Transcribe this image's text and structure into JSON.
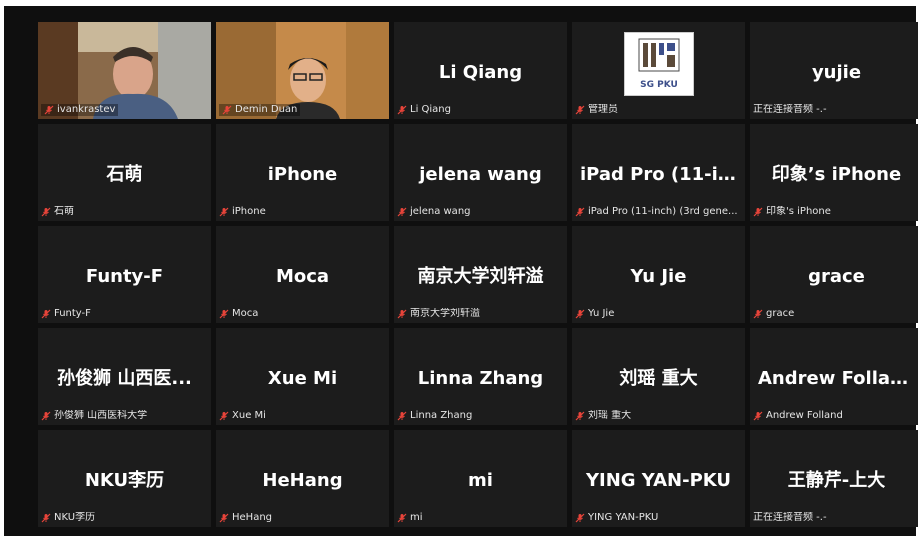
{
  "tiles": [
    {
      "type": "video",
      "variant": "speaker",
      "label": "ivankrastev"
    },
    {
      "type": "video",
      "variant": "man",
      "label": "Demin Duan"
    },
    {
      "title": "Li Qiang",
      "label": "Li Qiang"
    },
    {
      "type": "logo",
      "logo_text": "SG PKU",
      "label": "管理员"
    },
    {
      "title": "yujie",
      "label": "正在连接音频 -.-",
      "no_mic": true
    },
    {
      "title": "石萌",
      "label": "石萌"
    },
    {
      "title": "iPhone",
      "label": "iPhone"
    },
    {
      "title": "jelena wang",
      "label": "jelena wang"
    },
    {
      "title": "iPad Pro (11-inc...",
      "label": "iPad Pro (11-inch) (3rd gene..."
    },
    {
      "title": "印象’s iPhone",
      "label": "印象's iPhone"
    },
    {
      "title": "Funty-F",
      "label": "Funty-F"
    },
    {
      "title": "Moca",
      "label": "Moca"
    },
    {
      "title": "南京大学刘轩溢",
      "label": "南京大学刘轩溢"
    },
    {
      "title": "Yu Jie",
      "label": "Yu Jie"
    },
    {
      "title": "grace",
      "label": "grace"
    },
    {
      "title": "孙俊狮 山西医...",
      "label": "孙俊狮 山西医科大学"
    },
    {
      "title": "Xue Mi",
      "label": "Xue Mi"
    },
    {
      "title": "Linna Zhang",
      "label": "Linna Zhang"
    },
    {
      "title": "刘瑶  重大",
      "label": "刘瑶  重大"
    },
    {
      "title": "Andrew Folland",
      "label": "Andrew Folland"
    },
    {
      "title": "NKU李历",
      "label": "NKU李历"
    },
    {
      "title": "HeHang",
      "label": "HeHang"
    },
    {
      "title": "mi",
      "label": "mi"
    },
    {
      "title": "YING YAN-PKU",
      "label": "YING YAN-PKU"
    },
    {
      "title": "王静芹-上大",
      "label": "正在连接音频 -.-",
      "no_mic": true
    }
  ],
  "colors": {
    "muted_mic": "#e8443a",
    "active_border": "#c8dc3c"
  },
  "icons": {
    "mic": "muted-mic-icon"
  }
}
